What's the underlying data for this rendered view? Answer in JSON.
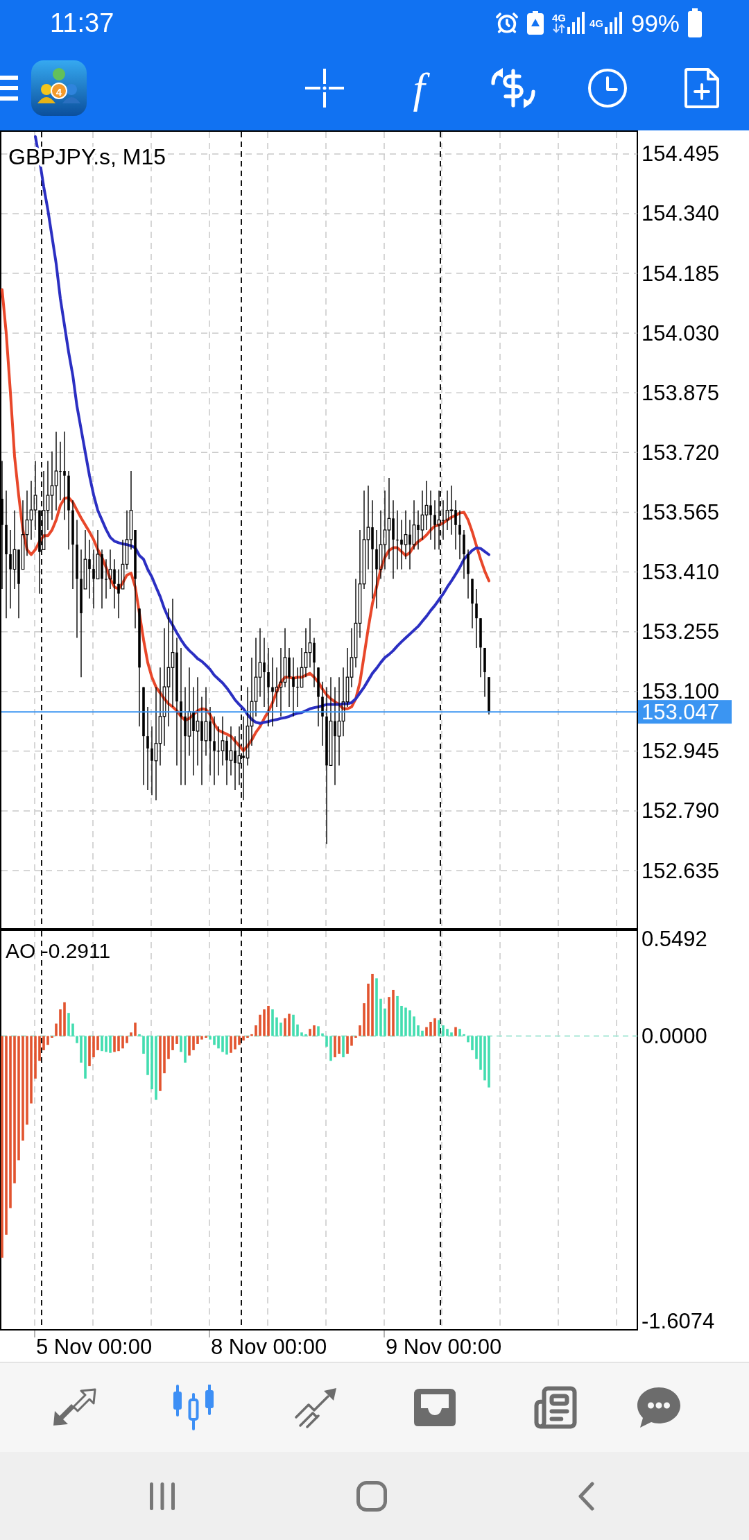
{
  "status_bar": {
    "time": "11:37",
    "network_labels": [
      "4G",
      "4G"
    ],
    "battery": "99%"
  },
  "toolbar": {
    "indicator_symbol": "f"
  },
  "app_logo": {
    "badge": "4"
  },
  "price_chart": {
    "chart_data": {
      "type": "candlestick",
      "title": "GBPJPY.s, M15",
      "grid": true,
      "ylim": [
        152.482,
        154.556
      ],
      "yticks": [
        154.495,
        {
          "value": 154.34,
          "label": "154.340"
        },
        154.185,
        {
          "value": 154.03,
          "label": "154.030"
        },
        153.875,
        {
          "value": 153.72,
          "label": "153.720"
        },
        153.565,
        {
          "value": 153.41,
          "label": "153.410"
        },
        153.255,
        {
          "value": 153.1,
          "label": "153.100"
        },
        152.945,
        {
          "value": 152.79,
          "label": "152.790"
        },
        152.635
      ],
      "ohlc": [
        [
          153.6,
          153.698,
          153.366,
          153.532
        ],
        [
          153.532,
          153.621,
          153.29,
          153.456
        ],
        [
          153.456,
          153.519,
          153.315,
          153.417
        ],
        [
          153.417,
          153.57,
          153.366,
          153.468
        ],
        [
          153.468,
          153.468,
          153.29,
          153.379
        ],
        [
          153.417,
          153.596,
          153.417,
          153.507
        ],
        [
          153.507,
          153.621,
          153.452,
          153.545
        ],
        [
          153.545,
          153.647,
          153.494,
          153.571
        ],
        [
          153.571,
          153.698,
          153.519,
          153.609
        ],
        [
          153.57,
          153.57,
          153.354,
          153.462
        ],
        [
          153.468,
          153.672,
          153.468,
          153.57
        ],
        [
          153.57,
          153.698,
          153.519,
          153.609
        ],
        [
          153.609,
          153.723,
          153.545,
          153.634
        ],
        [
          153.634,
          153.774,
          153.57,
          153.672
        ],
        [
          153.672,
          153.748,
          153.596,
          153.672
        ],
        [
          153.672,
          153.774,
          153.545,
          153.66
        ],
        [
          153.66,
          153.672,
          153.468,
          153.57
        ],
        [
          153.57,
          153.596,
          153.366,
          153.481
        ],
        [
          153.481,
          153.545,
          153.239,
          153.392
        ],
        [
          153.392,
          153.468,
          153.137,
          153.303
        ],
        [
          153.366,
          153.519,
          153.366,
          153.443
        ],
        [
          153.443,
          153.494,
          153.341,
          153.418
        ],
        [
          153.418,
          153.468,
          153.315,
          153.392
        ],
        [
          153.392,
          153.519,
          153.392,
          153.456
        ],
        [
          153.456,
          153.468,
          153.315,
          153.392
        ],
        [
          153.392,
          153.443,
          153.341,
          153.392
        ],
        [
          153.392,
          153.468,
          153.366,
          153.417
        ],
        [
          153.417,
          153.443,
          153.315,
          153.379
        ],
        [
          153.379,
          153.417,
          153.29,
          153.354
        ],
        [
          153.366,
          153.494,
          153.366,
          153.43
        ],
        [
          153.43,
          153.57,
          153.417,
          153.494
        ],
        [
          153.494,
          153.672,
          153.468,
          153.57
        ],
        [
          153.519,
          153.519,
          153.264,
          153.392
        ],
        [
          153.315,
          153.315,
          153.009,
          153.162
        ],
        [
          153.111,
          153.111,
          152.857,
          152.984
        ],
        [
          152.984,
          153.06,
          152.844,
          152.952
        ],
        [
          152.952,
          153.009,
          152.831,
          152.92
        ],
        [
          152.92,
          153.111,
          152.818,
          152.965
        ],
        [
          152.965,
          153.162,
          152.908,
          153.035
        ],
        [
          153.035,
          153.264,
          152.959,
          153.112
        ],
        [
          153.112,
          153.315,
          153.009,
          153.162
        ],
        [
          153.162,
          153.341,
          153.06,
          153.201
        ],
        [
          153.201,
          153.239,
          152.908,
          153.074
        ],
        [
          153.074,
          153.213,
          152.857,
          153.035
        ],
        [
          153.035,
          153.111,
          152.857,
          152.984
        ],
        [
          152.984,
          153.162,
          152.933,
          153.048
        ],
        [
          153.048,
          153.111,
          152.882,
          152.997
        ],
        [
          152.997,
          153.137,
          152.908,
          153.023
        ],
        [
          153.023,
          153.086,
          152.857,
          152.972
        ],
        [
          152.972,
          153.111,
          152.933,
          153.022
        ],
        [
          153.022,
          153.06,
          152.882,
          152.971
        ],
        [
          152.971,
          153.035,
          152.857,
          152.946
        ],
        [
          152.946,
          153.009,
          152.882,
          152.946
        ],
        [
          152.946,
          153.035,
          152.908,
          152.972
        ],
        [
          152.972,
          152.984,
          152.857,
          152.921
        ],
        [
          152.921,
          153.009,
          152.882,
          152.946
        ],
        [
          152.946,
          152.984,
          152.844,
          152.914
        ],
        [
          152.914,
          153.009,
          152.857,
          152.933
        ],
        [
          152.933,
          153.035,
          152.818,
          152.927
        ],
        [
          152.927,
          153.111,
          152.908,
          153.01
        ],
        [
          153.01,
          153.188,
          152.959,
          153.074
        ],
        [
          153.074,
          153.239,
          153.035,
          153.137
        ],
        [
          153.137,
          153.264,
          153.086,
          153.175
        ],
        [
          153.175,
          153.239,
          153.06,
          153.15
        ],
        [
          153.15,
          153.213,
          153.009,
          153.111
        ],
        [
          153.111,
          153.188,
          153.009,
          153.099
        ],
        [
          153.099,
          153.162,
          153.06,
          153.111
        ],
        [
          153.111,
          153.213,
          153.035,
          153.124
        ],
        [
          153.124,
          153.264,
          153.111,
          153.188
        ],
        [
          153.188,
          153.213,
          153.06,
          153.137
        ],
        [
          153.137,
          153.188,
          153.035,
          153.112
        ],
        [
          153.112,
          153.162,
          153.06,
          153.111
        ],
        [
          153.111,
          153.213,
          153.111,
          153.162
        ],
        [
          153.162,
          153.264,
          153.137,
          153.201
        ],
        [
          153.201,
          153.29,
          153.162,
          153.226
        ],
        [
          153.226,
          153.239,
          153.111,
          153.175
        ],
        [
          153.162,
          153.162,
          153.009,
          153.086
        ],
        [
          153.086,
          153.125,
          152.959,
          153.035
        ],
        [
          153.035,
          153.111,
          152.704,
          152.908
        ],
        [
          152.908,
          153.137,
          152.908,
          153.023
        ],
        [
          153.023,
          153.111,
          152.857,
          152.984
        ],
        [
          152.984,
          153.137,
          152.908,
          153.023
        ],
        [
          153.023,
          153.162,
          152.984,
          153.073
        ],
        [
          153.073,
          153.213,
          153.06,
          153.137
        ],
        [
          153.137,
          153.264,
          153.111,
          153.188
        ],
        [
          153.188,
          153.392,
          153.162,
          153.277
        ],
        [
          153.277,
          153.519,
          153.239,
          153.379
        ],
        [
          153.379,
          153.621,
          153.366,
          153.494
        ],
        [
          153.494,
          153.634,
          153.417,
          153.526
        ],
        [
          153.526,
          153.596,
          153.341,
          153.469
        ],
        [
          153.469,
          153.519,
          153.315,
          153.417
        ],
        [
          153.417,
          153.57,
          153.392,
          153.481
        ],
        [
          153.481,
          153.621,
          153.417,
          153.519
        ],
        [
          153.519,
          153.654,
          153.443,
          153.549
        ],
        [
          153.549,
          153.596,
          153.392,
          153.494
        ],
        [
          153.494,
          153.57,
          153.417,
          153.494
        ],
        [
          153.494,
          153.545,
          153.417,
          153.481
        ],
        [
          153.481,
          153.57,
          153.443,
          153.507
        ],
        [
          153.507,
          153.545,
          153.417,
          153.481
        ],
        [
          153.481,
          153.596,
          153.468,
          153.532
        ],
        [
          153.532,
          153.57,
          153.468,
          153.519
        ],
        [
          153.519,
          153.621,
          153.494,
          153.558
        ],
        [
          153.558,
          153.647,
          153.519,
          153.583
        ],
        [
          153.583,
          153.621,
          153.494,
          153.558
        ],
        [
          153.558,
          153.596,
          153.468,
          153.532
        ],
        [
          153.532,
          153.621,
          153.468,
          153.545
        ],
        [
          153.545,
          153.596,
          153.494,
          153.545
        ],
        [
          153.545,
          153.621,
          153.519,
          153.57
        ],
        [
          153.57,
          153.634,
          153.507,
          153.571
        ],
        [
          153.571,
          153.596,
          153.468,
          153.532
        ],
        [
          153.532,
          153.57,
          153.443,
          153.507
        ],
        [
          153.507,
          153.519,
          153.392,
          153.456
        ],
        [
          153.456,
          153.468,
          153.341,
          153.405
        ],
        [
          153.392,
          153.392,
          153.264,
          153.328
        ],
        [
          153.328,
          153.366,
          153.213,
          153.29
        ],
        [
          153.29,
          153.29,
          153.137,
          153.214
        ],
        [
          153.213,
          153.213,
          153.086,
          153.15
        ],
        [
          153.137,
          153.137,
          153.04,
          153.047
        ],
        null,
        null,
        null,
        null,
        null,
        null,
        null,
        null,
        null,
        null,
        null,
        null,
        null,
        null,
        null,
        null,
        null,
        null,
        null,
        null,
        null,
        null,
        null,
        null,
        null,
        null,
        null,
        null,
        null,
        null,
        null,
        null,
        null,
        null,
        null
      ],
      "series": [
        {
          "type": "line",
          "color": "#e8472a",
          "values": [
            154.143,
            154.029,
            153.876,
            153.71,
            153.608,
            153.519,
            153.468,
            153.455,
            153.468,
            153.489,
            153.504,
            153.504,
            153.519,
            153.545,
            153.583,
            153.601,
            153.603,
            153.591,
            153.57,
            153.55,
            153.532,
            153.514,
            153.494,
            153.468,
            153.448,
            153.422,
            153.392,
            153.371,
            153.366,
            153.382,
            153.402,
            153.407,
            153.371,
            153.303,
            153.234,
            153.175,
            153.137,
            153.111,
            153.096,
            153.081,
            153.068,
            153.06,
            153.05,
            153.035,
            153.025,
            153.03,
            153.04,
            153.05,
            153.055,
            153.053,
            153.04,
            153.015,
            152.999,
            152.994,
            152.989,
            152.984,
            152.971,
            152.959,
            152.946,
            152.959,
            152.974,
            152.994,
            153.009,
            153.03,
            153.048,
            153.071,
            153.099,
            153.124,
            153.137,
            153.137,
            153.134,
            153.137,
            153.137,
            153.142,
            153.147,
            153.137,
            153.124,
            153.106,
            153.091,
            153.081,
            153.073,
            153.066,
            153.055,
            153.055,
            153.06,
            153.081,
            153.124,
            153.193,
            153.264,
            153.328,
            153.371,
            153.417,
            153.448,
            153.466,
            153.473,
            153.473,
            153.463,
            153.453,
            153.46,
            153.478,
            153.489,
            153.496,
            153.506,
            153.519,
            153.529,
            153.532,
            153.537,
            153.545,
            153.552,
            153.557,
            153.563,
            153.565,
            153.545,
            153.514,
            153.478,
            153.443,
            153.412,
            153.387,
            null,
            null,
            null,
            null,
            null,
            null,
            null,
            null,
            null,
            null,
            null,
            null,
            null,
            null,
            null,
            null,
            null,
            null,
            null,
            null,
            null,
            null,
            null,
            null,
            null,
            null,
            null,
            null,
            null,
            null,
            null,
            null,
            null,
            null,
            null
          ]
        },
        {
          "type": "line",
          "color": "#2b2fc2",
          "values": [
            null,
            null,
            null,
            null,
            null,
            null,
            null,
            null,
            154.54,
            154.48,
            154.41,
            154.35,
            154.28,
            154.21,
            154.12,
            154.05,
            153.98,
            153.92,
            153.84,
            153.78,
            153.72,
            153.66,
            153.61,
            153.57,
            153.545,
            153.52,
            153.5,
            153.49,
            153.486,
            153.483,
            153.481,
            153.478,
            153.473,
            153.453,
            153.443,
            153.417,
            153.397,
            153.371,
            153.346,
            153.315,
            153.29,
            153.272,
            153.252,
            153.234,
            153.218,
            153.206,
            153.196,
            153.185,
            153.178,
            153.168,
            153.157,
            153.142,
            153.132,
            153.122,
            153.109,
            153.094,
            153.078,
            153.066,
            153.055,
            153.04,
            153.027,
            153.02,
            153.017,
            153.02,
            153.022,
            153.025,
            153.027,
            153.03,
            153.032,
            153.035,
            153.04,
            153.043,
            153.045,
            153.05,
            153.055,
            153.058,
            153.06,
            153.063,
            153.066,
            153.066,
            153.066,
            153.066,
            153.068,
            153.068,
            153.071,
            153.081,
            153.096,
            153.111,
            153.129,
            153.147,
            153.16,
            153.175,
            153.188,
            153.196,
            153.206,
            153.218,
            153.229,
            153.239,
            153.249,
            153.259,
            153.269,
            153.282,
            153.295,
            153.31,
            153.323,
            153.338,
            153.353,
            153.371,
            153.387,
            153.404,
            153.422,
            153.443,
            153.455,
            153.466,
            153.473,
            153.471,
            153.463,
            153.455,
            null,
            null,
            null,
            null,
            null,
            null,
            null,
            null,
            null,
            null,
            null,
            null,
            null,
            null,
            null,
            null,
            null,
            null,
            null,
            null,
            null,
            null,
            null,
            null,
            null,
            null,
            null,
            null,
            null,
            null,
            null,
            null,
            null,
            null,
            null
          ]
        }
      ],
      "ref_lines": [
        {
          "axis": "y",
          "value": 153.047,
          "label": "153.047",
          "color": "#3b95f2"
        }
      ]
    }
  },
  "indicator_chart": {
    "chart_data": {
      "type": "bar",
      "title": "AO -0.2911",
      "grid": true,
      "ylim": [
        -1.66,
        0.6
      ],
      "yticks": [
        0.5492,
        {
          "value": 0,
          "label": "0.0000"
        },
        -1.6074
      ],
      "stacked": true,
      "series": [
        {
          "color": "#e2542f",
          "values": [
            -1.25,
            -1.12,
            -0.97,
            -0.83,
            -0.7,
            -0.59,
            -0.5,
            -0.38,
            -0.24,
            -0.14,
            -0.08,
            -0.05,
            -0.01,
            0.07,
            0.15,
            0.19,
            null,
            null,
            null,
            null,
            null,
            -0.17,
            -0.12,
            -0.08,
            null,
            null,
            null,
            -0.09,
            -0.085,
            -0.07,
            -0.04,
            0.02,
            0.075,
            null,
            null,
            null,
            null,
            null,
            -0.31,
            -0.21,
            -0.13,
            -0.08,
            -0.045,
            null,
            null,
            -0.11,
            -0.08,
            -0.045,
            -0.02,
            -0.01,
            null,
            null,
            null,
            null,
            null,
            -0.095,
            -0.075,
            -0.05,
            -0.025,
            -0.01,
            0.01,
            0.06,
            0.12,
            0.15,
            0.17,
            null,
            null,
            null,
            0.1,
            0.125,
            null,
            null,
            null,
            null,
            0.04,
            0.06,
            null,
            null,
            null,
            null,
            -0.12,
            -0.1,
            null,
            -0.1,
            -0.055,
            -0.01,
            0.06,
            0.185,
            0.295,
            0.35,
            null,
            null,
            null,
            0.22,
            0.26,
            null,
            null,
            null,
            null,
            null,
            null,
            null,
            0.05,
            0.08,
            0.1,
            null,
            null,
            null,
            null,
            0.05,
            null,
            null,
            null,
            null,
            null,
            null,
            null,
            null,
            null,
            null,
            null,
            null,
            null,
            null,
            null,
            null,
            null,
            null,
            null,
            null,
            null,
            null,
            null,
            null,
            null,
            null,
            null,
            null,
            null,
            null,
            null,
            null,
            null,
            null,
            null,
            null,
            null,
            null,
            null,
            null,
            null
          ]
        },
        {
          "color": "#43ddb0",
          "values": [
            null,
            null,
            null,
            null,
            null,
            null,
            null,
            null,
            null,
            null,
            null,
            null,
            null,
            null,
            null,
            null,
            0.13,
            0.07,
            -0.04,
            -0.15,
            -0.24,
            null,
            null,
            null,
            -0.085,
            -0.09,
            -0.095,
            null,
            null,
            null,
            null,
            null,
            null,
            0.01,
            -0.1,
            -0.22,
            -0.3,
            -0.36,
            null,
            null,
            null,
            null,
            null,
            -0.09,
            -0.15,
            null,
            null,
            null,
            null,
            null,
            -0.02,
            -0.05,
            -0.07,
            -0.09,
            -0.105,
            null,
            null,
            null,
            null,
            null,
            null,
            null,
            null,
            null,
            null,
            0.15,
            0.105,
            0.075,
            null,
            null,
            0.12,
            0.065,
            0.02,
            0.01,
            null,
            null,
            0.055,
            0.015,
            -0.06,
            -0.14,
            null,
            null,
            -0.12,
            null,
            null,
            null,
            null,
            null,
            null,
            null,
            0.325,
            0.21,
            0.155,
            null,
            null,
            0.225,
            0.17,
            0.16,
            0.145,
            0.11,
            0.06,
            0.03,
            null,
            null,
            null,
            0.09,
            0.06,
            0.04,
            0.02,
            null,
            0.04,
            0.01,
            -0.035,
            -0.08,
            -0.13,
            -0.19,
            -0.25,
            -0.29,
            null,
            null,
            null,
            null,
            null,
            null,
            null,
            null,
            null,
            null,
            null,
            null,
            null,
            null,
            null,
            null,
            null,
            null,
            null,
            null,
            null,
            null,
            null,
            null,
            null,
            null,
            null,
            null,
            null,
            null,
            null,
            null,
            null,
            null,
            null
          ]
        }
      ],
      "ref_lines": [
        {
          "axis": "y",
          "value": 0,
          "color": "#a6e8d6"
        }
      ]
    },
    "time_axis": {
      "labels": [
        "5 Nov 00:00",
        "8 Nov 00:00",
        "9 Nov 00:00"
      ]
    }
  },
  "bottom_tabs": [
    {
      "selected": false
    },
    {
      "selected": true
    },
    {
      "selected": false
    },
    {
      "selected": false
    },
    {
      "selected": false
    },
    {
      "selected": false
    }
  ]
}
